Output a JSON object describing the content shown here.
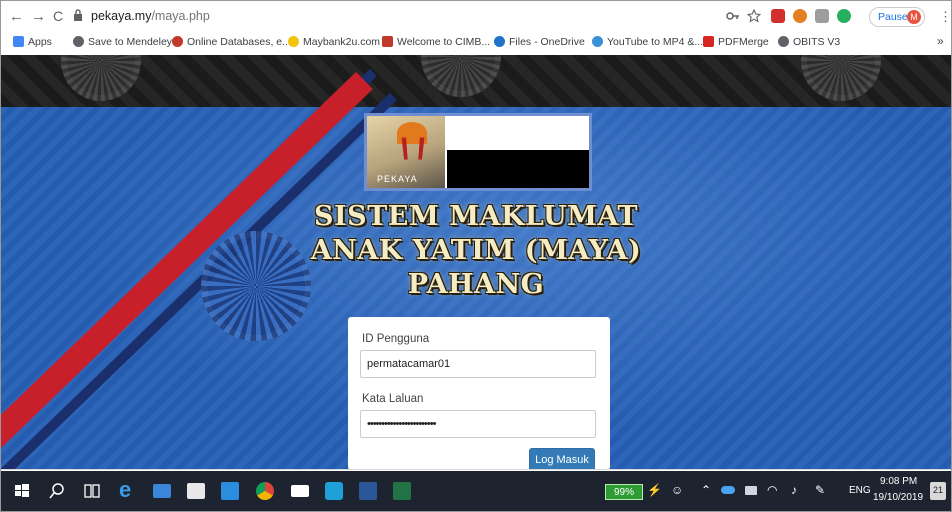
{
  "browser": {
    "url_host": "pekaya.my",
    "url_path": "/maya.php",
    "profile_status": "Paused",
    "profile_initial": "M",
    "back_glyph": "←",
    "forward_glyph": "→",
    "reload_glyph": "C",
    "menu_glyph": "⋮"
  },
  "bookmarks": [
    {
      "label": "Apps",
      "icon": "apps-grid-icon",
      "color": "#4285f4"
    },
    {
      "label": "Save to Mendeley",
      "icon": "globe-icon",
      "color": "#5f6368"
    },
    {
      "label": "Online Databases, e...",
      "icon": "database-icon",
      "color": "#c0392b"
    },
    {
      "label": "Maybank2u.com",
      "icon": "maybank-icon",
      "color": "#f1c40f"
    },
    {
      "label": "Welcome to CIMB...",
      "icon": "cimb-icon",
      "color": "#c0392b"
    },
    {
      "label": "Files - OneDrive",
      "icon": "onedrive-icon",
      "color": "#1e73c8"
    },
    {
      "label": "YouTube to MP4 &...",
      "icon": "youtube-mp4-icon",
      "color": "#3a8fd6"
    },
    {
      "label": "PDFMerge",
      "icon": "pdf-icon",
      "color": "#d7261e"
    },
    {
      "label": "OBITS V3",
      "icon": "globe-icon",
      "color": "#5f6368"
    }
  ],
  "bookmarks_overflow": "»",
  "page": {
    "logo_text": "PEKAYA",
    "title_lines": [
      "SISTEM MAKLUMAT",
      "ANAK YATIM (MAYA)",
      "PAHANG"
    ],
    "login": {
      "user_label": "ID Pengguna",
      "user_value": "permatacamar01",
      "password_label": "Kata Laluan",
      "password_value": "••••••••••••••••••••••••",
      "submit_label": "Log Masuk"
    }
  },
  "taskbar": {
    "battery": "99%",
    "language": "ENG",
    "time": "9:08 PM",
    "date": "19/10/2019",
    "notifications": "21"
  },
  "colors": {
    "page_blue": "#2660b6",
    "stripe_red": "#c8202a",
    "button_blue": "#337ab7",
    "taskbar": "#1d2430"
  }
}
